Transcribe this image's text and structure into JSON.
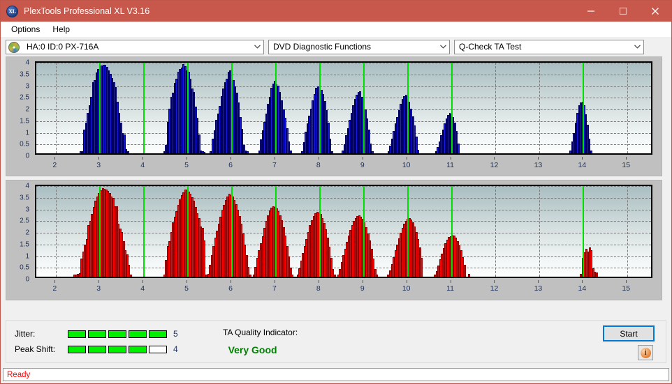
{
  "window": {
    "title": "PlexTools Professional XL V3.16",
    "icon": "xl-app-icon",
    "icon_text": "XL",
    "minimize": "minimize-icon",
    "maximize": "maximize-icon",
    "close": "close-icon",
    "titlebar_color": "#c8584b"
  },
  "menu": {
    "items": [
      {
        "label": "Options"
      },
      {
        "label": "Help"
      }
    ]
  },
  "toolbar": {
    "drive": "HA:0 ID:0  PX-716A",
    "function": "DVD Diagnostic Functions",
    "test": "Q-Check TA Test"
  },
  "bottom": {
    "jitter_label": "Jitter:",
    "jitter_value": "5",
    "jitter_filled": 5,
    "jitter_total": 5,
    "peakshift_label": "Peak Shift:",
    "peakshift_value": "4",
    "peakshift_filled": 4,
    "peakshift_total": 5,
    "tqi_label": "TA Quality Indicator:",
    "tqi_value": "Very Good",
    "tqi_color": "#008000",
    "start_label": "Start",
    "info_label": "i"
  },
  "statusbar": {
    "text": "Ready"
  },
  "chart_data": [
    {
      "type": "bar",
      "title": "",
      "id": "ta-test-chart-top",
      "color": "#1a1ae0",
      "marker_color": "#00e000",
      "xlabel": "",
      "ylabel": "",
      "xlim": [
        1.55,
        15.6
      ],
      "ylim": [
        0,
        4
      ],
      "yticks": [
        0,
        0.5,
        1,
        1.5,
        2,
        2.5,
        3,
        3.5,
        4
      ],
      "ytick_labels": [
        "0",
        "0.5",
        "1",
        "1.5",
        "2",
        "2.5",
        "3",
        "3.5",
        "4"
      ],
      "xticks": [
        2,
        3,
        4,
        5,
        6,
        7,
        8,
        9,
        10,
        11,
        12,
        13,
        14,
        15
      ],
      "xtick_labels": [
        "2",
        "3",
        "4",
        "5",
        "6",
        "7",
        "8",
        "9",
        "10",
        "11",
        "12",
        "13",
        "14",
        "15"
      ],
      "grid": true,
      "markers": [
        3,
        4,
        5,
        6,
        7,
        8,
        9,
        10,
        11,
        14
      ],
      "x": [
        2.56,
        2.6,
        2.64,
        2.68,
        2.72,
        2.76,
        2.8,
        2.84,
        2.88,
        2.92,
        2.96,
        3.0,
        3.04,
        3.08,
        3.12,
        3.16,
        3.2,
        3.24,
        3.28,
        3.32,
        3.36,
        3.4,
        3.44,
        3.48,
        3.52,
        3.56,
        3.6,
        3.64,
        4.46,
        4.5,
        4.54,
        4.58,
        4.62,
        4.66,
        4.7,
        4.74,
        4.78,
        4.82,
        4.86,
        4.9,
        4.94,
        4.98,
        5.02,
        5.06,
        5.1,
        5.14,
        5.18,
        5.22,
        5.26,
        5.3,
        5.34,
        5.38,
        5.52,
        5.56,
        5.6,
        5.64,
        5.68,
        5.72,
        5.76,
        5.8,
        5.84,
        5.88,
        5.92,
        5.96,
        6.0,
        6.04,
        6.08,
        6.12,
        6.16,
        6.2,
        6.24,
        6.28,
        6.32,
        6.36,
        6.62,
        6.66,
        6.7,
        6.74,
        6.78,
        6.82,
        6.86,
        6.9,
        6.94,
        6.98,
        7.02,
        7.06,
        7.1,
        7.14,
        7.18,
        7.22,
        7.26,
        7.3,
        7.34,
        7.6,
        7.64,
        7.68,
        7.72,
        7.76,
        7.8,
        7.84,
        7.88,
        7.92,
        7.96,
        8.0,
        8.04,
        8.08,
        8.12,
        8.16,
        8.2,
        8.24,
        8.28,
        8.52,
        8.56,
        8.6,
        8.64,
        8.68,
        8.72,
        8.76,
        8.8,
        8.84,
        8.88,
        8.92,
        8.96,
        9.0,
        9.04,
        9.08,
        9.12,
        9.16,
        9.2,
        9.56,
        9.6,
        9.64,
        9.68,
        9.72,
        9.76,
        9.8,
        9.84,
        9.88,
        9.92,
        9.96,
        10.0,
        10.04,
        10.08,
        10.12,
        10.16,
        10.2,
        10.24,
        10.64,
        10.68,
        10.72,
        10.76,
        10.8,
        10.84,
        10.88,
        10.92,
        10.96,
        11.0,
        11.04,
        11.08,
        11.12,
        11.16,
        13.7,
        13.74,
        13.78,
        13.82,
        13.86,
        13.9,
        13.94,
        13.98,
        14.02,
        14.06,
        14.1,
        14.14,
        14.18
      ],
      "values": [
        0.08,
        0.1,
        1.02,
        1.3,
        1.72,
        2.05,
        2.42,
        3.05,
        3.12,
        3.46,
        3.6,
        3.5,
        3.75,
        3.8,
        3.78,
        3.7,
        3.55,
        3.4,
        3.22,
        3.05,
        2.85,
        2.2,
        1.72,
        1.32,
        0.88,
        0.82,
        0.18,
        0.1,
        0.1,
        0.35,
        1.34,
        1.9,
        2.42,
        2.6,
        3.02,
        3.18,
        3.48,
        3.62,
        3.68,
        3.81,
        3.74,
        3.54,
        3.5,
        3.18,
        2.78,
        2.62,
        2.0,
        1.52,
        0.8,
        0.12,
        0.1,
        0.06,
        0.1,
        0.62,
        1.0,
        1.42,
        1.7,
        2.02,
        2.46,
        2.78,
        3.06,
        3.2,
        3.48,
        3.54,
        3.3,
        3.14,
        2.88,
        2.6,
        2.18,
        1.56,
        1.05,
        0.35,
        0.12,
        0.08,
        0.12,
        0.6,
        1.0,
        1.35,
        1.7,
        2.12,
        2.42,
        2.82,
        3.0,
        3.1,
        2.96,
        2.9,
        2.62,
        2.26,
        1.88,
        1.52,
        1.08,
        0.52,
        0.12,
        0.1,
        0.48,
        0.92,
        1.28,
        1.6,
        1.92,
        2.28,
        2.55,
        2.8,
        2.88,
        2.86,
        2.72,
        2.55,
        2.25,
        1.85,
        1.3,
        0.62,
        0.1,
        0.12,
        0.4,
        0.78,
        1.08,
        1.42,
        1.72,
        2.05,
        2.32,
        2.52,
        2.64,
        2.65,
        2.42,
        2.18,
        1.88,
        1.48,
        1.02,
        0.42,
        0.1,
        0.08,
        0.32,
        0.62,
        0.96,
        1.28,
        1.55,
        1.86,
        2.12,
        2.32,
        2.45,
        2.5,
        2.48,
        2.2,
        1.92,
        1.58,
        1.2,
        0.72,
        0.15,
        0.08,
        0.28,
        0.52,
        0.78,
        1.02,
        1.28,
        1.48,
        1.64,
        1.72,
        1.7,
        1.55,
        1.3,
        0.95,
        0.42,
        0.12,
        0.5,
        0.88,
        1.32,
        1.72,
        2.05,
        2.18,
        2.2,
        2.05,
        1.68,
        1.22,
        0.62,
        0.12
      ]
    },
    {
      "type": "bar",
      "title": "",
      "id": "ta-test-chart-bottom",
      "color": "#fa0000",
      "marker_color": "#00e000",
      "xlabel": "",
      "ylabel": "",
      "xlim": [
        1.55,
        15.6
      ],
      "ylim": [
        0,
        4
      ],
      "yticks": [
        0,
        0.5,
        1,
        1.5,
        2,
        2.5,
        3,
        3.5,
        4
      ],
      "ytick_labels": [
        "0",
        "0.5",
        "1",
        "1.5",
        "2",
        "2.5",
        "3",
        "3.5",
        "4"
      ],
      "xticks": [
        2,
        3,
        4,
        5,
        6,
        7,
        8,
        9,
        10,
        11,
        12,
        13,
        14,
        15
      ],
      "xtick_labels": [
        "2",
        "3",
        "4",
        "5",
        "6",
        "7",
        "8",
        "9",
        "10",
        "11",
        "12",
        "13",
        "14",
        "15"
      ],
      "grid": true,
      "markers": [
        3,
        4,
        5,
        6,
        7,
        8,
        9,
        10,
        11,
        14
      ],
      "x": [
        2.42,
        2.46,
        2.5,
        2.54,
        2.58,
        2.62,
        2.66,
        2.7,
        2.74,
        2.78,
        2.82,
        2.86,
        2.9,
        2.94,
        2.98,
        3.02,
        3.06,
        3.1,
        3.14,
        3.18,
        3.22,
        3.26,
        3.3,
        3.34,
        3.38,
        3.42,
        3.46,
        3.5,
        3.54,
        3.58,
        3.62,
        3.66,
        3.7,
        4.46,
        4.5,
        4.54,
        4.58,
        4.62,
        4.66,
        4.7,
        4.74,
        4.78,
        4.82,
        4.86,
        4.9,
        4.94,
        4.98,
        5.02,
        5.06,
        5.1,
        5.14,
        5.18,
        5.22,
        5.26,
        5.3,
        5.34,
        5.38,
        5.42,
        5.46,
        5.5,
        5.54,
        5.58,
        5.62,
        5.66,
        5.7,
        5.74,
        5.78,
        5.82,
        5.86,
        5.9,
        5.94,
        5.98,
        6.02,
        6.06,
        6.1,
        6.14,
        6.18,
        6.22,
        6.26,
        6.3,
        6.34,
        6.38,
        6.42,
        6.5,
        6.54,
        6.58,
        6.62,
        6.66,
        6.7,
        6.74,
        6.78,
        6.82,
        6.86,
        6.9,
        6.94,
        6.98,
        7.02,
        7.06,
        7.1,
        7.14,
        7.18,
        7.22,
        7.26,
        7.3,
        7.34,
        7.38,
        7.5,
        7.54,
        7.58,
        7.62,
        7.66,
        7.7,
        7.74,
        7.78,
        7.82,
        7.86,
        7.9,
        7.94,
        7.98,
        8.02,
        8.06,
        8.1,
        8.14,
        8.18,
        8.22,
        8.26,
        8.3,
        8.34,
        8.42,
        8.46,
        8.5,
        8.54,
        8.58,
        8.62,
        8.66,
        8.7,
        8.74,
        8.78,
        8.82,
        8.86,
        8.9,
        8.94,
        8.98,
        9.02,
        9.06,
        9.1,
        9.14,
        9.18,
        9.22,
        9.26,
        9.3,
        9.56,
        9.6,
        9.64,
        9.68,
        9.72,
        9.76,
        9.8,
        9.84,
        9.88,
        9.92,
        9.96,
        10.0,
        10.04,
        10.08,
        10.12,
        10.16,
        10.2,
        10.24,
        10.28,
        10.32,
        10.62,
        10.66,
        10.7,
        10.74,
        10.78,
        10.82,
        10.86,
        10.9,
        10.94,
        10.98,
        11.02,
        11.06,
        11.1,
        11.14,
        11.18,
        11.22,
        11.26,
        11.3,
        11.4,
        13.94,
        13.98,
        14.02,
        14.06,
        14.1,
        14.14,
        14.18,
        14.22,
        14.26,
        14.3
      ],
      "values": [
        0.08,
        0.1,
        0.12,
        0.14,
        0.78,
        1.08,
        1.38,
        1.62,
        2.22,
        2.38,
        2.68,
        3.0,
        3.24,
        3.42,
        3.58,
        3.7,
        3.8,
        3.76,
        3.74,
        3.66,
        3.58,
        3.42,
        3.38,
        3.02,
        3.02,
        2.28,
        2.06,
        1.92,
        1.52,
        1.12,
        0.95,
        0.52,
        0.1,
        0.1,
        0.72,
        1.32,
        1.52,
        1.9,
        2.32,
        2.58,
        2.82,
        3.08,
        3.3,
        3.48,
        3.62,
        3.72,
        3.74,
        3.64,
        3.56,
        3.4,
        3.24,
        3.0,
        2.72,
        2.52,
        2.14,
        2.1,
        1.54,
        0.1,
        0.12,
        0.5,
        0.92,
        1.3,
        1.68,
        1.98,
        2.28,
        2.58,
        2.88,
        3.08,
        3.28,
        3.44,
        3.54,
        3.5,
        3.42,
        3.28,
        3.1,
        2.88,
        2.6,
        2.28,
        1.86,
        1.38,
        0.92,
        0.42,
        0.1,
        0.1,
        0.42,
        0.8,
        1.12,
        1.44,
        1.74,
        2.08,
        2.38,
        2.62,
        2.84,
        2.96,
        3.02,
        3.0,
        2.94,
        2.82,
        2.64,
        2.42,
        2.12,
        1.76,
        1.32,
        0.88,
        0.38,
        0.1,
        0.1,
        0.36,
        0.7,
        1.02,
        1.32,
        1.62,
        1.92,
        2.2,
        2.42,
        2.6,
        2.72,
        2.78,
        2.76,
        2.68,
        2.52,
        2.3,
        2.02,
        1.68,
        1.28,
        0.82,
        0.34,
        0.1,
        0.1,
        0.32,
        0.62,
        0.92,
        1.2,
        1.48,
        1.76,
        2.0,
        2.2,
        2.38,
        2.52,
        2.6,
        2.62,
        2.58,
        2.48,
        2.34,
        2.12,
        1.86,
        1.54,
        1.18,
        0.78,
        0.32,
        0.1,
        0.1,
        0.28,
        0.55,
        0.85,
        1.12,
        1.38,
        1.64,
        1.88,
        2.08,
        2.26,
        2.4,
        2.48,
        2.5,
        2.44,
        2.32,
        2.14,
        1.9,
        1.6,
        1.24,
        0.82,
        0.1,
        0.24,
        0.48,
        0.74,
        0.98,
        1.22,
        1.42,
        1.58,
        1.7,
        1.74,
        1.78,
        1.76,
        1.66,
        1.52,
        1.34,
        1.12,
        0.84,
        0.5,
        0.12,
        0.12,
        0.82,
        1.06,
        1.2,
        1.08,
        1.26,
        1.14,
        0.36,
        0.22,
        0.18
      ]
    }
  ]
}
